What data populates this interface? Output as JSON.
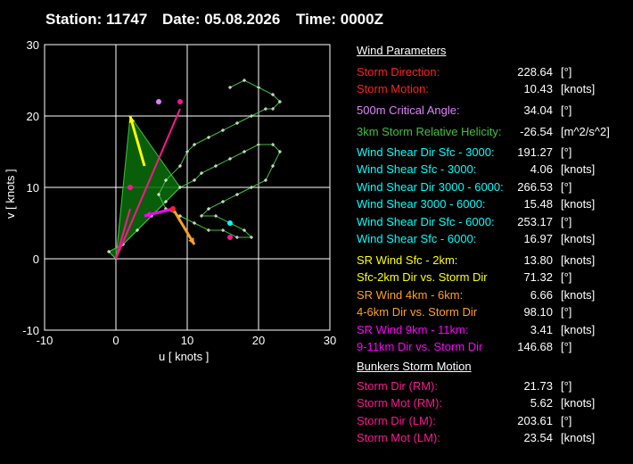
{
  "header": {
    "station": "Station: 11747",
    "date": "Date: 05.08.2026",
    "time": "Time: 0000Z"
  },
  "chart_data": {
    "type": "scatter",
    "xlabel": "u  [ knots ]",
    "ylabel": "v  [ knots ]",
    "xlim": [
      -10,
      30
    ],
    "ylim": [
      -10,
      30
    ],
    "xticks": [
      "-10",
      "0",
      "10",
      "20",
      "30"
    ],
    "yticks": [
      "-10",
      "0",
      "10",
      "20",
      "30"
    ],
    "grid": true,
    "hodograph": {
      "name": "hodograph",
      "color": "#40c040",
      "points": [
        [
          0,
          0
        ],
        [
          -1,
          1
        ],
        [
          1,
          2
        ],
        [
          3,
          4
        ],
        [
          5,
          6
        ],
        [
          7,
          8
        ],
        [
          9,
          10
        ],
        [
          11,
          11
        ],
        [
          12,
          12
        ],
        [
          14,
          13
        ],
        [
          16,
          14
        ],
        [
          18,
          15
        ],
        [
          20,
          16
        ],
        [
          22,
          16
        ],
        [
          23,
          15
        ],
        [
          22,
          13
        ],
        [
          21,
          11
        ],
        [
          19,
          10
        ],
        [
          17,
          9
        ],
        [
          15,
          8
        ],
        [
          13,
          7
        ],
        [
          12,
          6
        ],
        [
          14,
          6
        ],
        [
          16,
          5
        ],
        [
          18,
          4
        ],
        [
          19,
          3
        ],
        [
          17,
          3
        ],
        [
          15,
          4
        ],
        [
          13,
          4
        ],
        [
          11,
          5
        ],
        [
          9,
          6
        ],
        [
          7,
          7
        ],
        [
          6,
          9
        ],
        [
          7,
          11
        ],
        [
          9,
          13
        ],
        [
          10,
          15
        ],
        [
          11,
          16
        ],
        [
          13,
          17
        ],
        [
          15,
          18
        ],
        [
          17,
          19
        ],
        [
          19,
          20
        ],
        [
          21,
          21
        ],
        [
          22,
          21
        ],
        [
          23,
          22
        ],
        [
          22,
          23
        ],
        [
          20,
          24
        ],
        [
          18,
          25
        ],
        [
          16,
          24
        ]
      ]
    },
    "storm_vectors": [
      {
        "name": "storm-motion-rm",
        "color": "#ff1493",
        "from": [
          0,
          0
        ],
        "to": [
          2,
          7
        ]
      },
      {
        "name": "storm-motion-lm",
        "color": "#ff1493",
        "from": [
          0,
          0
        ],
        "to": [
          9,
          21
        ]
      }
    ],
    "sr_wind_vectors": [
      {
        "name": "sr-wind-sfc-2km",
        "color": "#ffff00",
        "from": [
          4,
          13
        ],
        "to": [
          2,
          20
        ]
      },
      {
        "name": "sr-wind-4-6km",
        "color": "#ffa020",
        "from": [
          8,
          7
        ],
        "to": [
          11,
          2
        ]
      },
      {
        "name": "sr-wind-9-11km",
        "color": "#ff00ff",
        "from": [
          8,
          7
        ],
        "to": [
          4,
          6
        ]
      }
    ],
    "points": [
      {
        "name": "critical-angle-point",
        "color": "#e080ff",
        "u": 6,
        "v": 22
      },
      {
        "name": "shear-6km-point",
        "color": "#00ffff",
        "u": 16,
        "v": 5
      },
      {
        "name": "bunkers-rm-point",
        "color": "#ff1493",
        "u": 16,
        "v": 3
      },
      {
        "name": "bunkers-lm-point",
        "color": "#ff1493",
        "u": 9,
        "v": 22
      },
      {
        "name": "mean-wind-point",
        "color": "#ff2020",
        "u": 8,
        "v": 7
      },
      {
        "name": "storm-motion-point",
        "color": "#ff1493",
        "u": 2,
        "v": 10
      }
    ]
  },
  "params": {
    "wind_header": "Wind Parameters",
    "bunkers_header": "Bunkers Storm Motion",
    "rows": [
      {
        "label": "Storm Direction:",
        "value": "228.64",
        "unit": "[°]",
        "color": "#ff2020"
      },
      {
        "label": "Storm Motion:",
        "value": "10.43",
        "unit": "[knots]",
        "color": "#ff2020"
      },
      {
        "label": "500m Critical Angle:",
        "value": "34.04",
        "unit": "[°]",
        "color": "#e080ff"
      },
      {
        "label": "3km Storm Relative Helicity:",
        "value": "-26.54",
        "unit": "[m^2/s^2]",
        "color": "#40c040"
      },
      {
        "label": "Wind Shear Dir Sfc - 3000:",
        "value": "191.27",
        "unit": "[°]",
        "color": "#00ffff"
      },
      {
        "label": "Wind Shear Sfc - 3000:",
        "value": "4.06",
        "unit": "[knots]",
        "color": "#00ffff"
      },
      {
        "label": "Wind Shear Dir 3000 - 6000:",
        "value": "266.53",
        "unit": "[°]",
        "color": "#00ffff"
      },
      {
        "label": "Wind Shear 3000 - 6000:",
        "value": "15.48",
        "unit": "[knots]",
        "color": "#00ffff"
      },
      {
        "label": "Wind Shear Dir Sfc - 6000:",
        "value": "253.17",
        "unit": "[°]",
        "color": "#00ffff"
      },
      {
        "label": "Wind Shear Sfc - 6000:",
        "value": "16.97",
        "unit": "[knots]",
        "color": "#00ffff"
      },
      {
        "label": "SR Wind Sfc - 2km:",
        "value": "13.80",
        "unit": "[knots]",
        "color": "#ffff00"
      },
      {
        "label": "Sfc-2km Dir vs. Storm Dir",
        "value": "71.32",
        "unit": "[°]",
        "color": "#ffff00"
      },
      {
        "label": "SR Wind 4km - 6km:",
        "value": "6.66",
        "unit": "[knots]",
        "color": "#ffa020"
      },
      {
        "label": "4-6km Dir vs. Storm Dir",
        "value": "98.10",
        "unit": "[°]",
        "color": "#ffa020"
      },
      {
        "label": "SR Wind 9km - 11km:",
        "value": "3.41",
        "unit": "[knots]",
        "color": "#ff00ff"
      },
      {
        "label": "9-11km Dir vs. Storm Dir",
        "value": "146.68",
        "unit": "[°]",
        "color": "#ff00ff"
      },
      {
        "label": "Storm Dir (RM):",
        "value": "21.73",
        "unit": "[°]",
        "color": "#ff1493"
      },
      {
        "label": "Storm Mot (RM):",
        "value": "5.62",
        "unit": "[knots]",
        "color": "#ff1493"
      },
      {
        "label": "Storm Dir (LM):",
        "value": "203.61",
        "unit": "[°]",
        "color": "#ff1493"
      },
      {
        "label": "Storm Mot (LM):",
        "value": "23.54",
        "unit": "[knots]",
        "color": "#ff1493"
      }
    ]
  }
}
